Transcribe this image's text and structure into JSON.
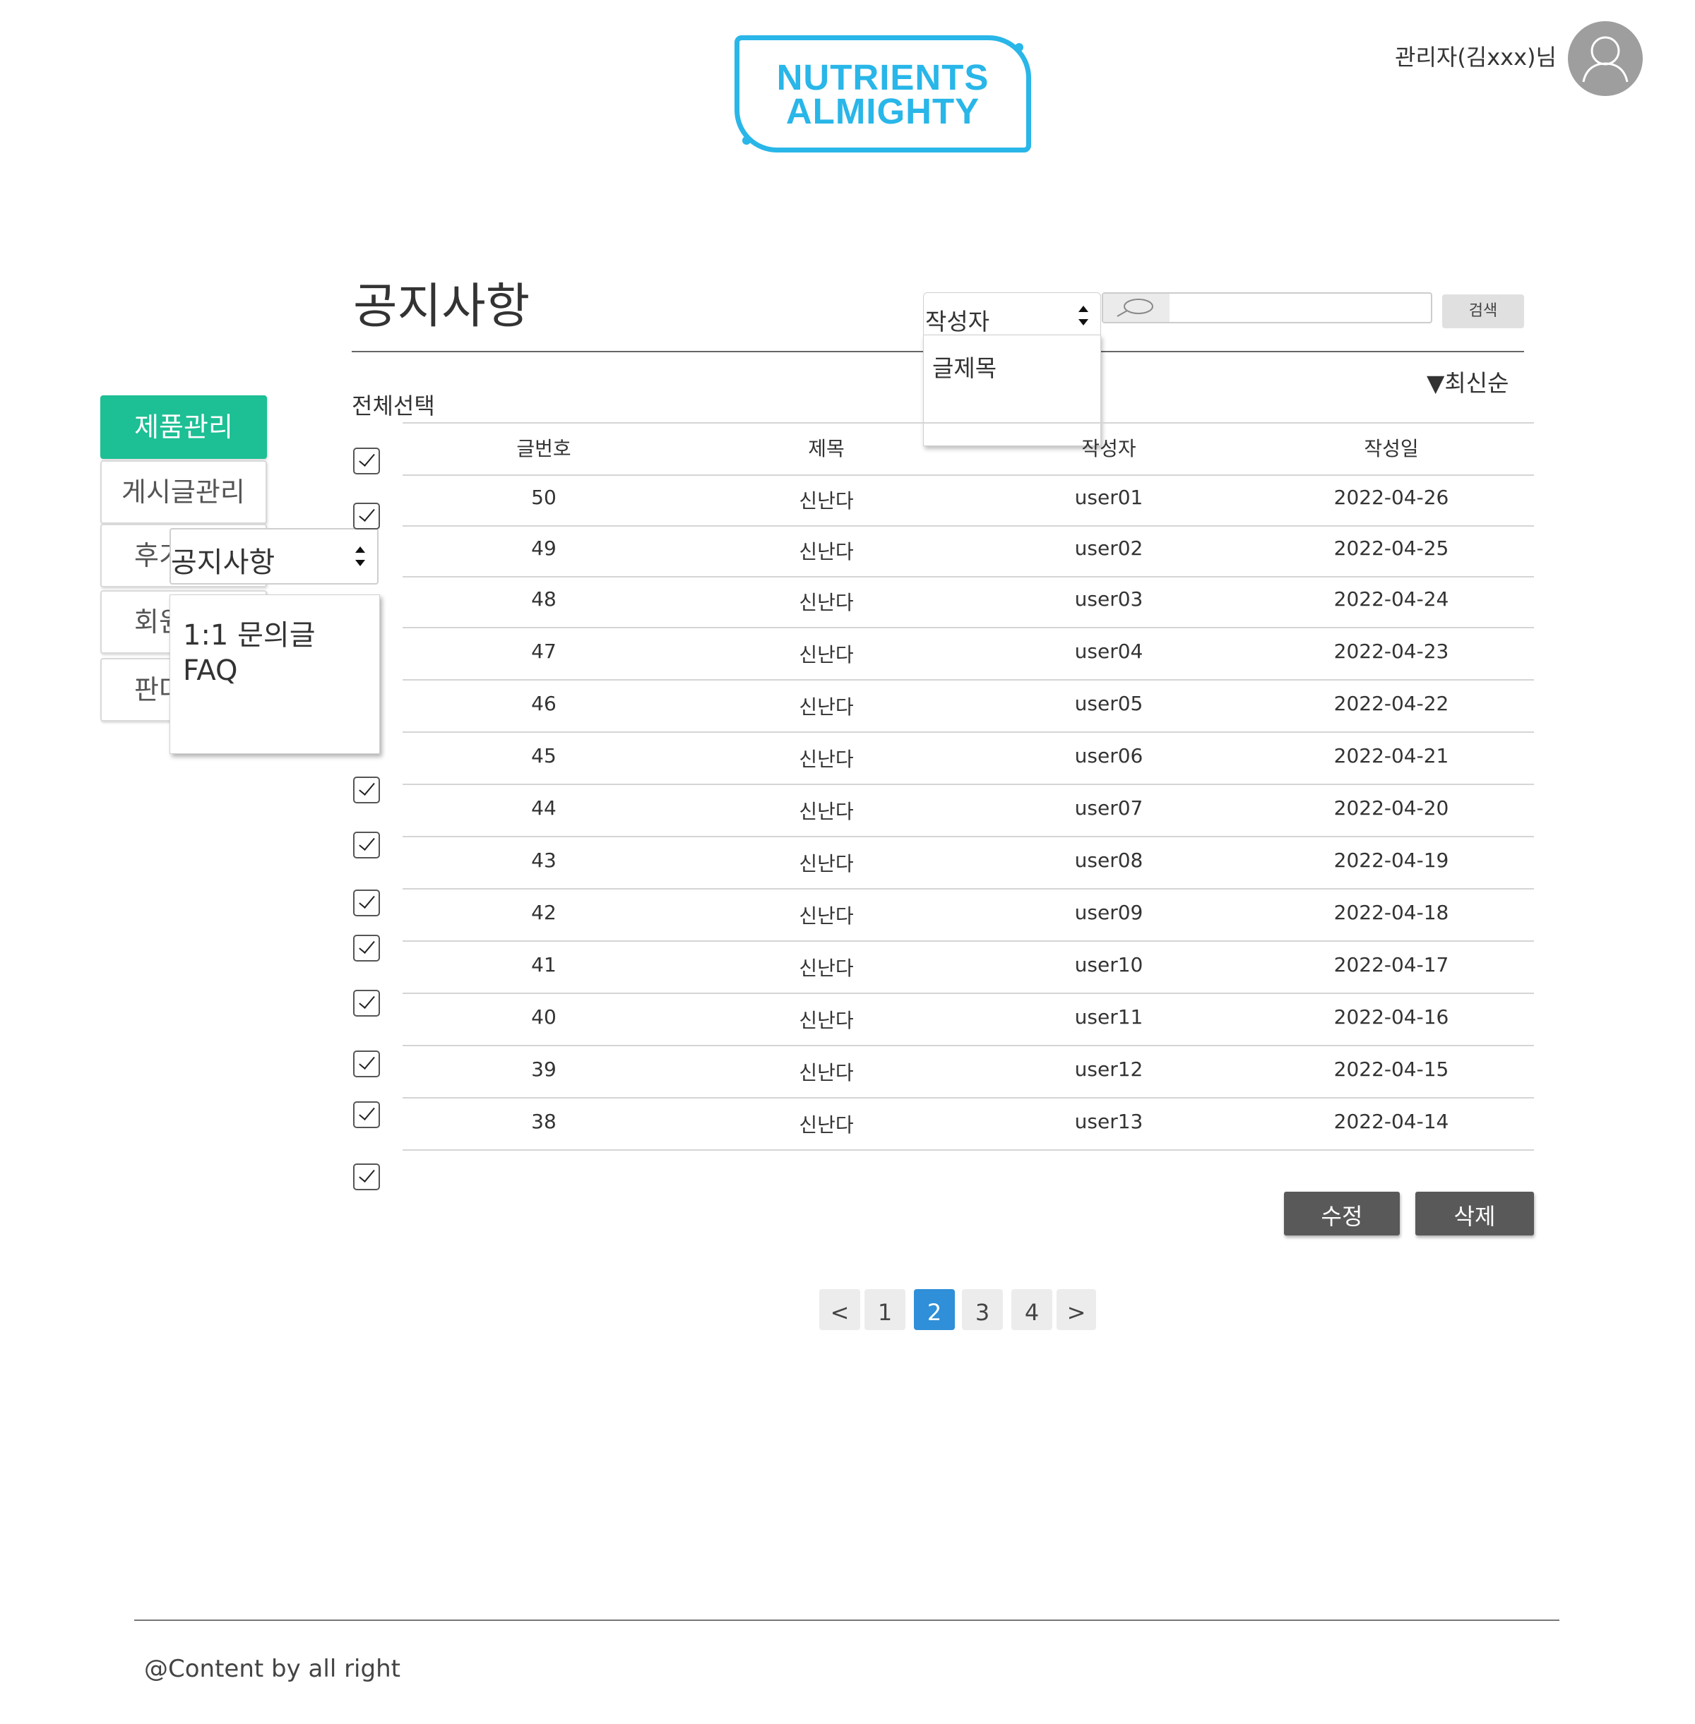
{
  "header": {
    "logo_line1": "NUTRIENTS",
    "logo_line2": "ALMIGHTY",
    "admin_label": "관리자(김xxx)님"
  },
  "page": {
    "title": "공지사항",
    "select_all": "전체선택",
    "sort_label": "▼최신순"
  },
  "search": {
    "selected": "작성자",
    "options": [
      "글제목"
    ],
    "query": "",
    "button": "검색"
  },
  "sidebar": {
    "items": [
      {
        "label": "제품관리",
        "active": true
      },
      {
        "label": "게시글관리"
      },
      {
        "label": "후기"
      },
      {
        "label": "회원"
      },
      {
        "label": "판다"
      }
    ],
    "board_select": {
      "selected": "공지사항",
      "options": [
        "1:1 문의글",
        "FAQ"
      ]
    }
  },
  "table": {
    "columns": [
      "글번호",
      "제목",
      "작성자",
      "작성일"
    ],
    "rows": [
      [
        "50",
        "신난다",
        "user01",
        "2022-04-26"
      ],
      [
        "49",
        "신난다",
        "user02",
        "2022-04-25"
      ],
      [
        "48",
        "신난다",
        "user03",
        "2022-04-24"
      ],
      [
        "47",
        "신난다",
        "user04",
        "2022-04-23"
      ],
      [
        "46",
        "신난다",
        "user05",
        "2022-04-22"
      ],
      [
        "45",
        "신난다",
        "user06",
        "2022-04-21"
      ],
      [
        "44",
        "신난다",
        "user07",
        "2022-04-20"
      ],
      [
        "43",
        "신난다",
        "user08",
        "2022-04-19"
      ],
      [
        "42",
        "신난다",
        "user09",
        "2022-04-18"
      ],
      [
        "41",
        "신난다",
        "user10",
        "2022-04-17"
      ],
      [
        "40",
        "신난다",
        "user11",
        "2022-04-16"
      ],
      [
        "39",
        "신난다",
        "user12",
        "2022-04-15"
      ],
      [
        "38",
        "신난다",
        "user13",
        "2022-04-14"
      ]
    ]
  },
  "actions": {
    "edit": "수정",
    "delete": "삭제"
  },
  "pagination": {
    "prev": "<",
    "pages": [
      "1",
      "2",
      "3",
      "4"
    ],
    "current": "2",
    "next": ">"
  },
  "footer": {
    "text": "@Content by all right"
  },
  "colors": {
    "brand": "#29b6e8",
    "active_menu": "#1dbf94",
    "current_page": "#2f8fd8",
    "action_button": "#595959"
  },
  "icons": {
    "avatar": "user-avatar-icon",
    "search": "search-icon",
    "checkbox": "checkbox-checked-icon"
  }
}
